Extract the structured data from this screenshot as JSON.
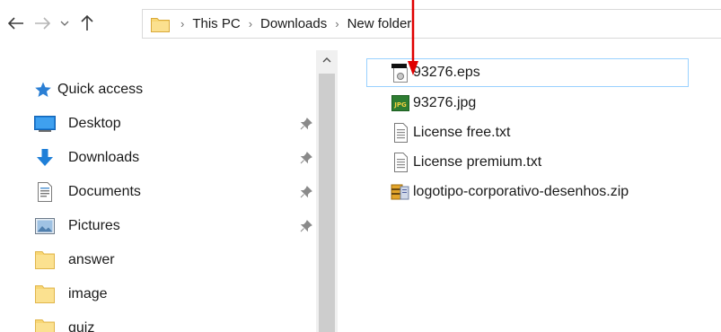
{
  "toolbar": {
    "back_icon": "arrow-left-icon",
    "forward_icon": "arrow-right-icon",
    "recent_icon": "chevron-down-icon",
    "up_icon": "arrow-up-icon"
  },
  "address_bar": {
    "breadcrumbs": [
      "This PC",
      "Downloads",
      "New folder"
    ]
  },
  "sidebar": {
    "quick_access": "Quick access",
    "items": [
      {
        "label": "Desktop",
        "icon": "desktop-icon",
        "pinned": true
      },
      {
        "label": "Downloads",
        "icon": "download-arrow-icon",
        "pinned": true
      },
      {
        "label": "Documents",
        "icon": "documents-icon",
        "pinned": true
      },
      {
        "label": "Pictures",
        "icon": "pictures-icon",
        "pinned": true
      },
      {
        "label": "answer",
        "icon": "folder-icon",
        "pinned": false
      },
      {
        "label": "image",
        "icon": "folder-icon",
        "pinned": false
      },
      {
        "label": "quiz",
        "icon": "folder-icon",
        "pinned": false
      }
    ]
  },
  "files": [
    {
      "name": "93276.eps",
      "icon": "eps-file-icon",
      "selected": true
    },
    {
      "name": "93276.jpg",
      "icon": "jpg-file-icon",
      "selected": false
    },
    {
      "name": "License free.txt",
      "icon": "text-file-icon",
      "selected": false
    },
    {
      "name": "License premium.txt",
      "icon": "text-file-icon",
      "selected": false
    },
    {
      "name": "logotipo-corporativo-desenhos.zip",
      "icon": "zip-file-icon",
      "selected": false
    }
  ],
  "colors": {
    "selection_border": "#99d1ff",
    "folder_yellow": "#f8d775",
    "accent_blue": "#1e7fd8",
    "annotation_red": "#e00000"
  }
}
